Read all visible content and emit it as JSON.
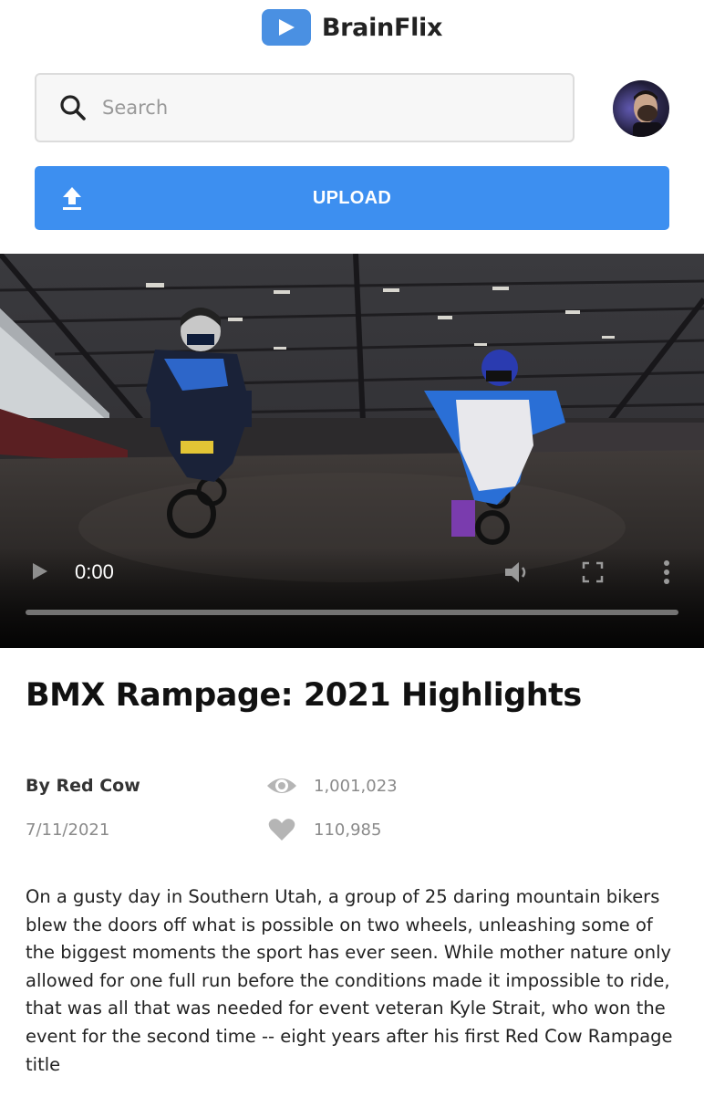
{
  "app": {
    "name": "BrainFlix"
  },
  "search": {
    "placeholder": "Search"
  },
  "upload": {
    "label": "UPLOAD"
  },
  "player": {
    "time": "0:00",
    "progress": 0
  },
  "video": {
    "title": "BMX Rampage: 2021 Highlights",
    "author": "By Red Cow",
    "date": "7/11/2021",
    "views": "1,001,023",
    "likes": "110,985",
    "description": "On a gusty day in Southern Utah, a group of 25 daring mountain bikers blew the doors off what is possible on two wheels, unleashing some of the biggest moments the sport has ever seen. While mother nature only allowed for one full run before the conditions made it impossible to ride, that was all that was needed for event veteran Kyle Strait, who won the event for the second time -- eight years after his first Red Cow Rampage title"
  },
  "icons": {
    "logo": "play-icon",
    "search": "search-icon",
    "upload": "upload-icon",
    "views": "eye-icon",
    "likes": "heart-icon",
    "play": "play-icon",
    "volume": "volume-icon",
    "fullscreen": "fullscreen-icon",
    "more": "more-vertical-icon"
  },
  "colors": {
    "brand": "#4a90e2",
    "upload_button": "#3d8ff0",
    "muted_text": "#8a8a8a"
  }
}
